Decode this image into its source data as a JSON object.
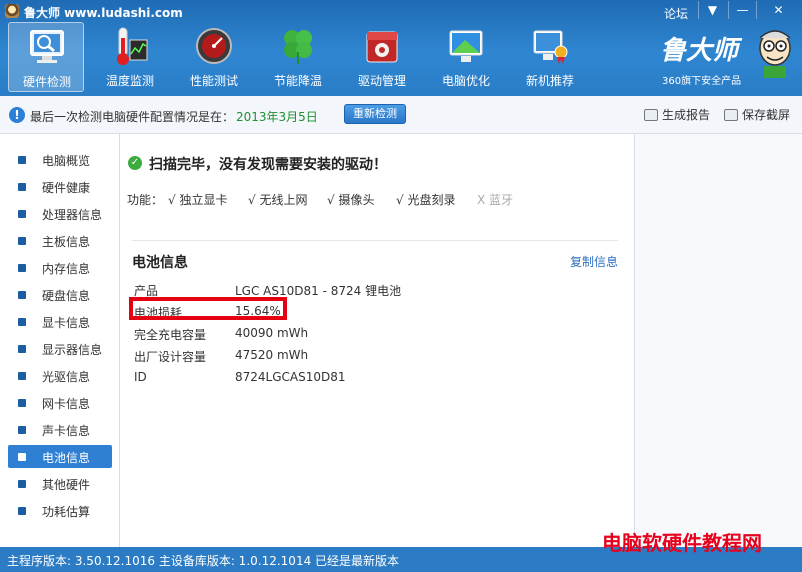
{
  "window": {
    "title": "鲁大师 www.ludashi.com",
    "forum_label": "论坛",
    "menu_glyph": "▼",
    "minimize_glyph": "—",
    "close_glyph": "✕"
  },
  "toolbar": {
    "items": [
      {
        "label": "硬件检测",
        "icon": "monitor-search-icon",
        "active": true
      },
      {
        "label": "温度监测",
        "icon": "thermometer-icon",
        "active": false
      },
      {
        "label": "性能测试",
        "icon": "speed-gauge-icon",
        "active": false
      },
      {
        "label": "节能降温",
        "icon": "clover-icon",
        "active": false
      },
      {
        "label": "驱动管理",
        "icon": "gear-box-icon",
        "active": false
      },
      {
        "label": "电脑优化",
        "icon": "optimize-screen-icon",
        "active": false
      },
      {
        "label": "新机推荐",
        "icon": "award-pc-icon",
        "active": false
      }
    ]
  },
  "brand": {
    "name": "鲁大师",
    "subtitle": "360旗下安全产品"
  },
  "infobar": {
    "icon": "!",
    "text": "最后一次检测电脑硬件配置情况是在：",
    "date": "2013年3月5日",
    "recheck_label": "重新检测",
    "report_label": "生成报告",
    "screenshot_label": "保存截屏"
  },
  "sidebar": {
    "items": [
      {
        "label": "电脑概览",
        "active": false
      },
      {
        "label": "硬件健康",
        "active": false
      },
      {
        "label": "处理器信息",
        "active": false
      },
      {
        "label": "主板信息",
        "active": false
      },
      {
        "label": "内存信息",
        "active": false
      },
      {
        "label": "硬盘信息",
        "active": false
      },
      {
        "label": "显卡信息",
        "active": false
      },
      {
        "label": "显示器信息",
        "active": false
      },
      {
        "label": "光驱信息",
        "active": false
      },
      {
        "label": "网卡信息",
        "active": false
      },
      {
        "label": "声卡信息",
        "active": false
      },
      {
        "label": "电池信息",
        "active": true
      },
      {
        "label": "其他硬件",
        "active": false
      },
      {
        "label": "功耗估算",
        "active": false
      }
    ]
  },
  "main": {
    "scan_icon": "✓",
    "scan_message": "扫描完毕，没有发现需要安装的驱动！",
    "features_label": "功能：",
    "features": [
      {
        "text": "√ 独立显卡",
        "enabled": true
      },
      {
        "text": "√ 无线上网",
        "enabled": true
      },
      {
        "text": "√ 摄像头",
        "enabled": true
      },
      {
        "text": "√ 光盘刻录",
        "enabled": true
      },
      {
        "text": "X 蓝牙",
        "enabled": false
      }
    ],
    "section_title": "电池信息",
    "copy_label": "复制信息",
    "battery_rows": [
      {
        "label": "产品",
        "value": "LGC AS10D81 -  8724 锂电池"
      },
      {
        "label": "电池损耗",
        "value": "15.64%"
      },
      {
        "label": "完全充电容量",
        "value": "40090 mWh"
      },
      {
        "label": "出厂设计容量",
        "value": "47520 mWh"
      },
      {
        "label": "ID",
        "value": "8724LGCAS10D81"
      }
    ]
  },
  "statusbar": {
    "text": "主程序版本: 3.50.12.1016  主设备库版本: 1.0.12.1014   已经是最新版本"
  },
  "watermark": "电脑软硬件教程网",
  "colors": {
    "header_blue": "#2f86d1",
    "active_blue": "#2f7fd2",
    "highlight_red": "#e50012",
    "date_green": "#1f8f2f",
    "link_blue": "#2d6fbd"
  }
}
